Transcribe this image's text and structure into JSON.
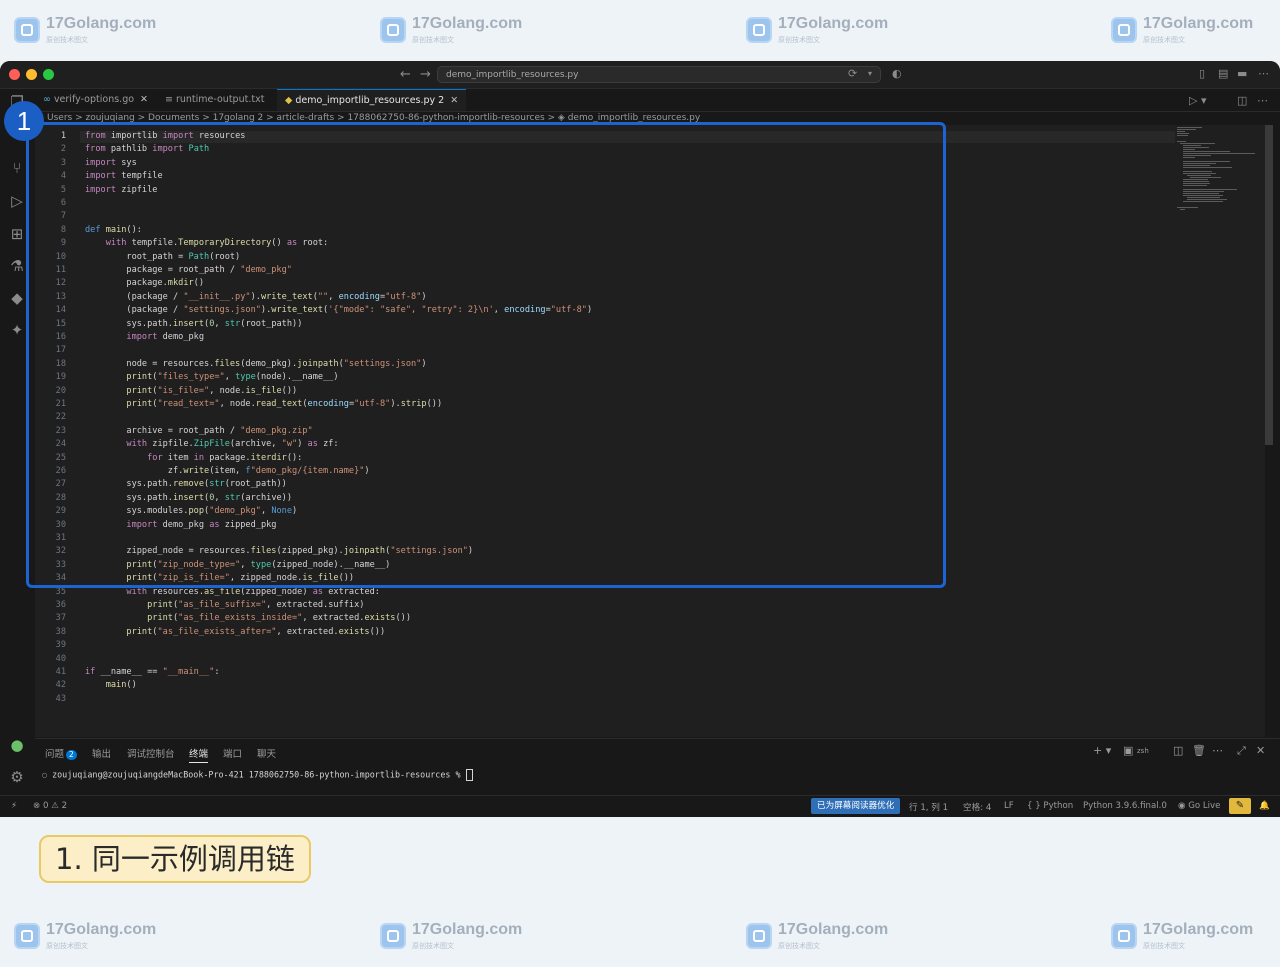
{
  "watermark": {
    "text": "17Golang.com",
    "subtext": "原创技术图文"
  },
  "titlebar": {
    "nav_back": "←",
    "nav_forward": "→",
    "command_center": "demo_importlib_resources.py"
  },
  "tabs": [
    {
      "label": "verify-options.go",
      "icon": "go-icon",
      "active": false
    },
    {
      "label": "runtime-output.txt",
      "icon": "text-file-icon",
      "active": false
    },
    {
      "label": "demo_importlib_resources.py 2",
      "icon": "python-icon",
      "active": true
    }
  ],
  "breadcrumb": "Users > zoujuqiang > Documents > 17golang 2 > article-drafts > 1788062750-86-python-importlib-resources > ◈ demo_importlib_resources.py",
  "code_lines": [
    {
      "n": "1",
      "html": "<span class=\"kw\">from</span> importlib <span class=\"kw\">import</span> resources"
    },
    {
      "n": "2",
      "html": "<span class=\"kw\">from</span> pathlib <span class=\"kw\">import</span> <span class=\"cl\">Path</span>"
    },
    {
      "n": "3",
      "html": "<span class=\"kw\">import</span> sys"
    },
    {
      "n": "4",
      "html": "<span class=\"kw\">import</span> tempfile"
    },
    {
      "n": "5",
      "html": "<span class=\"kw\">import</span> zipfile"
    },
    {
      "n": "6",
      "html": ""
    },
    {
      "n": "7",
      "html": ""
    },
    {
      "n": "8",
      "html": "<span class=\"kd\">def</span> <span class=\"fn\">main</span>():"
    },
    {
      "n": "9",
      "html": "    <span class=\"kw\">with</span> tempfile.<span class=\"fn\">TemporaryDirectory</span>() <span class=\"kw\">as</span> root:"
    },
    {
      "n": "10",
      "html": "        root_path = <span class=\"cl\">Path</span>(root)"
    },
    {
      "n": "11",
      "html": "        package = root_path / <span class=\"st\">\"demo_pkg\"</span>"
    },
    {
      "n": "12",
      "html": "        package.<span class=\"fn\">mkdir</span>()"
    },
    {
      "n": "13",
      "html": "        (package / <span class=\"st\">\"__init__.py\"</span>).<span class=\"fn\">write_text</span>(<span class=\"st\">\"\"</span>, <span class=\"vr\">encoding</span>=<span class=\"st\">\"utf-8\"</span>)"
    },
    {
      "n": "14",
      "html": "        (package / <span class=\"st\">\"settings.json\"</span>).<span class=\"fn\">write_text</span>(<span class=\"st\">'{\"mode\": \"safe\", \"retry\": 2}\\n'</span>, <span class=\"vr\">encoding</span>=<span class=\"st\">\"utf-8\"</span>)"
    },
    {
      "n": "15",
      "html": "        sys.path.<span class=\"fn\">insert</span>(<span class=\"nm\">0</span>, <span class=\"cl\">str</span>(root_path))"
    },
    {
      "n": "16",
      "html": "        <span class=\"kw\">import</span> demo_pkg"
    },
    {
      "n": "17",
      "html": ""
    },
    {
      "n": "18",
      "html": "        node = resources.<span class=\"fn\">files</span>(demo_pkg).<span class=\"fn\">joinpath</span>(<span class=\"st\">\"settings.json\"</span>)"
    },
    {
      "n": "19",
      "html": "        <span class=\"fn\">print</span>(<span class=\"st\">\"files_type=\"</span>, <span class=\"cl\">type</span>(node).__name__)"
    },
    {
      "n": "20",
      "html": "        <span class=\"fn\">print</span>(<span class=\"st\">\"is_file=\"</span>, node.<span class=\"fn\">is_file</span>())"
    },
    {
      "n": "21",
      "html": "        <span class=\"fn\">print</span>(<span class=\"st\">\"read_text=\"</span>, node.<span class=\"fn\">read_text</span>(<span class=\"vr\">encoding</span>=<span class=\"st\">\"utf-8\"</span>).<span class=\"fn\">strip</span>())"
    },
    {
      "n": "22",
      "html": ""
    },
    {
      "n": "23",
      "html": "        archive = root_path / <span class=\"st\">\"demo_pkg.zip\"</span>"
    },
    {
      "n": "24",
      "html": "        <span class=\"kw\">with</span> zipfile.<span class=\"cl\">ZipFile</span>(archive, <span class=\"st\">\"w\"</span>) <span class=\"kw\">as</span> zf:"
    },
    {
      "n": "25",
      "html": "            <span class=\"kw\">for</span> item <span class=\"kw\">in</span> package.<span class=\"fn\">iterdir</span>():"
    },
    {
      "n": "26",
      "html": "                zf.<span class=\"fn\">write</span>(item, <span class=\"bl\">f</span><span class=\"st\">\"demo_pkg/{item.name}\"</span>)"
    },
    {
      "n": "27",
      "html": "        sys.path.<span class=\"fn\">remove</span>(<span class=\"cl\">str</span>(root_path))"
    },
    {
      "n": "28",
      "html": "        sys.path.<span class=\"fn\">insert</span>(<span class=\"nm\">0</span>, <span class=\"cl\">str</span>(archive))"
    },
    {
      "n": "29",
      "html": "        sys.modules.<span class=\"fn\">pop</span>(<span class=\"st\">\"demo_pkg\"</span>, <span class=\"bl\">None</span>)"
    },
    {
      "n": "30",
      "html": "        <span class=\"kw\">import</span> demo_pkg <span class=\"kw\">as</span> zipped_pkg"
    },
    {
      "n": "31",
      "html": ""
    },
    {
      "n": "32",
      "html": "        zipped_node = resources.<span class=\"fn\">files</span>(zipped_pkg).<span class=\"fn\">joinpath</span>(<span class=\"st\">\"settings.json\"</span>)"
    },
    {
      "n": "33",
      "html": "        <span class=\"fn\">print</span>(<span class=\"st\">\"zip_node_type=\"</span>, <span class=\"cl\">type</span>(zipped_node).__name__)"
    },
    {
      "n": "34",
      "html": "        <span class=\"fn\">print</span>(<span class=\"st\">\"zip_is_file=\"</span>, zipped_node.<span class=\"fn\">is_file</span>())"
    },
    {
      "n": "35",
      "html": "        <span class=\"kw\">with</span> resources.<span class=\"fn\">as_file</span>(zipped_node) <span class=\"kw\">as</span> extracted:"
    },
    {
      "n": "36",
      "html": "            <span class=\"fn\">print</span>(<span class=\"st\">\"as_file_suffix=\"</span>, extracted.suffix)"
    },
    {
      "n": "37",
      "html": "            <span class=\"fn\">print</span>(<span class=\"st\">\"as_file_exists_inside=\"</span>, extracted.<span class=\"fn\">exists</span>())"
    },
    {
      "n": "38",
      "html": "        <span class=\"fn\">print</span>(<span class=\"st\">\"as_file_exists_after=\"</span>, extracted.<span class=\"fn\">exists</span>())"
    },
    {
      "n": "39",
      "html": ""
    },
    {
      "n": "40",
      "html": ""
    },
    {
      "n": "41",
      "html": "<span class=\"kw\">if</span> __name__ == <span class=\"st\">\"__main__\"</span>:"
    },
    {
      "n": "42",
      "html": "    <span class=\"fn\">main</span>()"
    },
    {
      "n": "43",
      "html": ""
    }
  ],
  "panel": {
    "tabs": [
      {
        "label": "问题",
        "badge": "2",
        "active": false
      },
      {
        "label": "输出",
        "active": false
      },
      {
        "label": "调试控制台",
        "active": false
      },
      {
        "label": "终端",
        "active": true
      },
      {
        "label": "端口",
        "active": false
      },
      {
        "label": "聊天",
        "active": false
      }
    ],
    "terminal_prompt": "zoujuqiang@zoujuqiangdeMacBook-Pro-421 1788062750-86-python-importlib-resources % ",
    "terminal_shell_label": "zsh"
  },
  "status": {
    "errors": "0",
    "warnings": "2",
    "screen_reader": "已为屏幕阅读器优化",
    "position": "行 1, 列 1",
    "indent": "空格: 4",
    "eol": "LF",
    "language": "Python",
    "interpreter": "Python 3.9.6.final.0",
    "go_live": "Go Live"
  },
  "annotation": {
    "marker": "1",
    "caption": "1. 同一示例调用链"
  },
  "colors": {
    "highlight": "#1c64d1",
    "caption_bg": "#fcefc8",
    "caption_border": "#e8c964",
    "status_accent": "#2f6fb7"
  }
}
